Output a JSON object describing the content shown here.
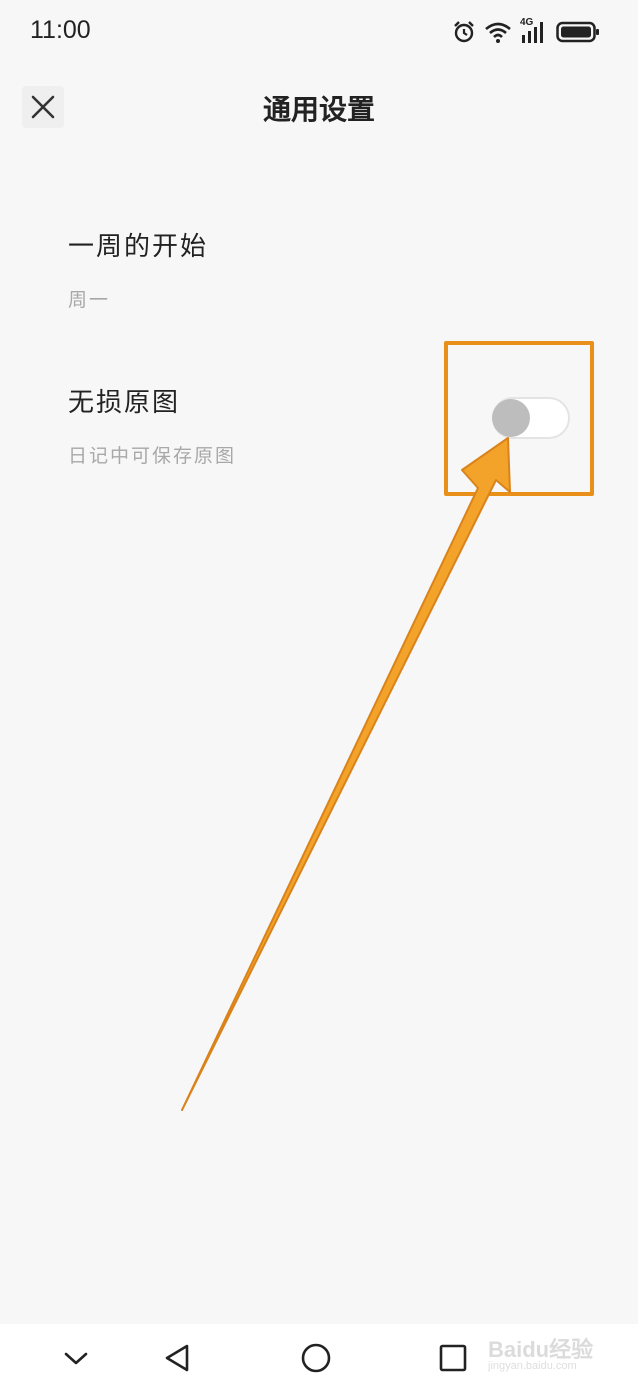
{
  "status_bar": {
    "time": "11:00",
    "network_label": "4G",
    "icons": [
      "alarm-icon",
      "wifi-icon",
      "signal-icon",
      "battery-icon"
    ]
  },
  "header": {
    "title": "通用设置",
    "close_icon": "close-icon"
  },
  "settings": [
    {
      "title": "一周的开始",
      "value": "周一"
    },
    {
      "title": "无损原图",
      "subtitle": "日记中可保存原图",
      "toggle_on": false
    }
  ],
  "annotation": {
    "color": "#e8901a"
  },
  "nav_bar": {
    "icons": [
      "chevron-down-icon",
      "back-triangle-icon",
      "home-circle-icon",
      "recent-square-icon"
    ]
  },
  "watermark": {
    "text": "Baidu经验",
    "url": "jingyan.baidu.com"
  }
}
